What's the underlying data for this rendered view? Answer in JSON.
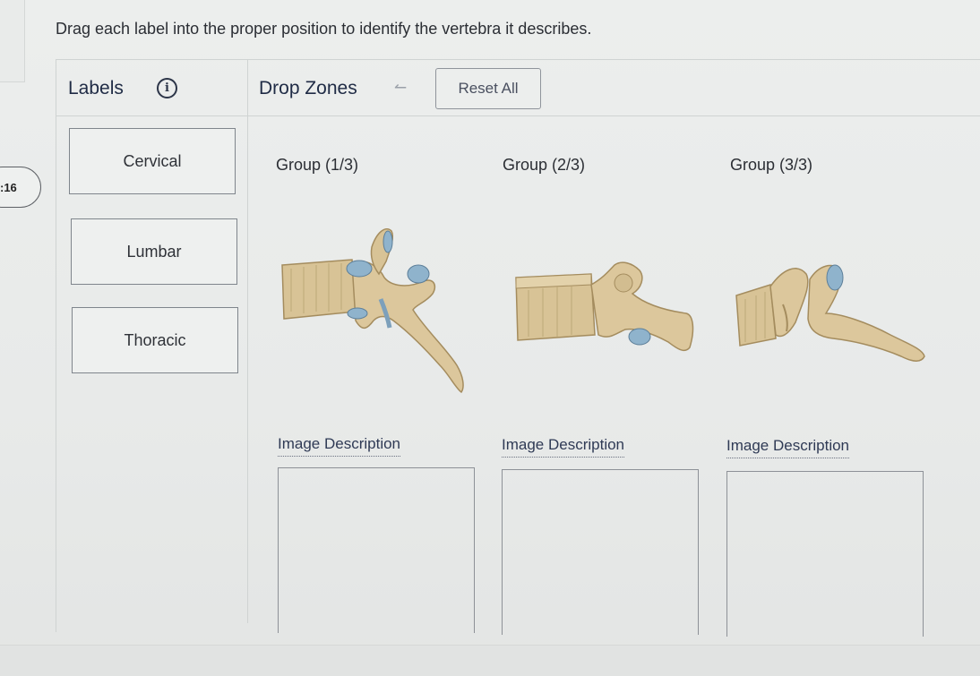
{
  "timer": {
    "text": ":16"
  },
  "instruction": "Drag each label into the proper position to identify the vertebra it describes.",
  "header": {
    "labels_title": "Labels",
    "info_icon": "i",
    "dropzones_title": "Drop Zones",
    "back_icon": "↼",
    "reset_label": "Reset All"
  },
  "labels": [
    "Cervical",
    "Lumbar",
    "Thoracic"
  ],
  "groups": [
    {
      "title": "Group (1/3)",
      "image_description": "Image Description"
    },
    {
      "title": "Group (2/3)",
      "image_description": "Image Description"
    },
    {
      "title": "Group (3/3)",
      "image_description": "Image Description"
    }
  ],
  "colors": {
    "bone": "#d9c49a",
    "bone_shadow": "#a99061",
    "cartilage": "#8fb3cc",
    "text_dark": "#1f2b45"
  }
}
